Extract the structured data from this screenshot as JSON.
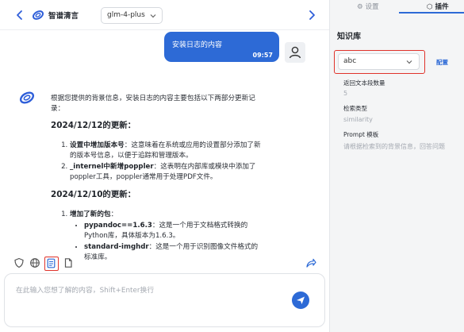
{
  "header": {
    "app_name": "智谱清言",
    "model": "glm-4-plus"
  },
  "conversation": {
    "user_message": "安装日志的内容",
    "user_time": "09:57",
    "assistant": {
      "intro": "根据您提供的背景信息，安装日志的内容主要包括以下两部分更新记录：",
      "sections": [
        {
          "heading": "2024/12/12的更新：",
          "items": [
            {
              "title": "设置中增加版本号",
              "text": "：这意味着在系统或应用的设置部分添加了新的版本号信息，以便于追踪和管理版本。"
            },
            {
              "title": "_internel中新增poppler",
              "text": "：这表明在内部库或模块中添加了poppler工具，poppler通常用于处理PDF文件。"
            }
          ]
        },
        {
          "heading": "2024/12/10的更新：",
          "items": [
            {
              "title": "增加了新的包",
              "text": "："
            }
          ],
          "subitems": [
            {
              "title": "pypandoc==1.6.3",
              "text": "：这是一个用于文档格式转换的Python库，具体版本为1.6.3。"
            },
            {
              "title": "standard-imghdr",
              "text": "：这是一个用于识别图像文件格式的标准库。"
            }
          ]
        }
      ]
    }
  },
  "input": {
    "placeholder": "在此输入您想了解的内容，Shift+Enter换行"
  },
  "sidebar": {
    "tabs": [
      {
        "label": "设置"
      },
      {
        "label": "插件"
      }
    ],
    "title": "知识库",
    "kb_value": "abc",
    "config_label": "配置",
    "fields": [
      {
        "label": "返回文本段数量",
        "value": "5"
      },
      {
        "label": "检索类型",
        "value": "similarity"
      },
      {
        "label": "Prompt 模板",
        "value": "请根据检索到的背景信息，回答问题"
      }
    ]
  },
  "colors": {
    "accent": "#2d6ad6",
    "highlight": "#e0332b"
  },
  "icons": [
    "back-icon",
    "forward-icon",
    "zhipu-logo-icon",
    "chevron-down-icon",
    "user-icon",
    "shield-icon",
    "globe-icon",
    "knowledge-base-icon",
    "file-icon",
    "send-icon",
    "gear-icon",
    "cube-icon"
  ]
}
